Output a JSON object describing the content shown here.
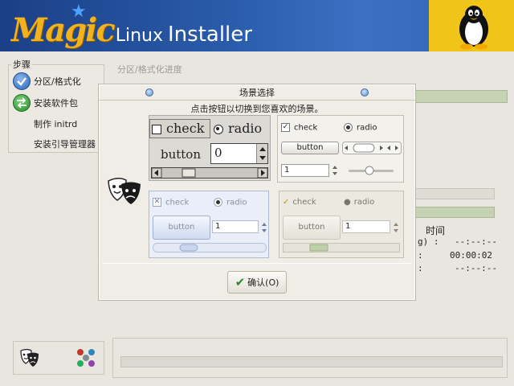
{
  "header": {
    "logo_magic": "Magic",
    "logo_linux": "Linux",
    "logo_installer": "Installer",
    "tux_icon": "tux-penguin-icon",
    "colors": {
      "banner": "#2a5cab",
      "logo": "#f1b21d",
      "tux_bg": "#f0c419"
    }
  },
  "steps": {
    "title": "步骤",
    "items": [
      {
        "label": "分区/格式化",
        "icon": "check-circle-icon"
      },
      {
        "label": "安装软件包",
        "icon": "arrows-swap-icon"
      },
      {
        "label": "制作 initrd",
        "icon": ""
      },
      {
        "label": "安装引导管理器",
        "icon": ""
      }
    ]
  },
  "background": {
    "section_title": "分区/格式化进度",
    "time_label": "时间",
    "time_rows": [
      {
        "prefix": "g) :",
        "value": "--:--:--"
      },
      {
        "prefix": ":",
        "value": "00:00:02"
      },
      {
        "prefix": ":",
        "value": "--:--:--"
      }
    ]
  },
  "dialog": {
    "title": "场景选择",
    "subtitle": "点击按钮以切换到您喜欢的场景。",
    "ok_label": "确认(O)",
    "themes": [
      {
        "check": "check",
        "radio": "radio",
        "button": "button",
        "spin": "0"
      },
      {
        "check": "check",
        "radio": "radio",
        "button": "button",
        "spin": "1"
      },
      {
        "check": "check",
        "radio": "radio",
        "button": "button",
        "spin": "1"
      },
      {
        "check": "check",
        "radio": "radio",
        "button": "button",
        "spin": "1"
      }
    ]
  }
}
